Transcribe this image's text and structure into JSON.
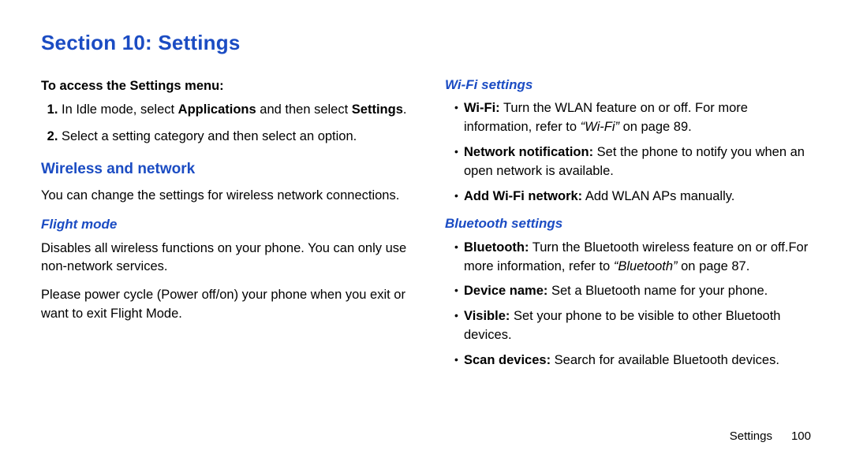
{
  "title": "Section 10: Settings",
  "left": {
    "access_heading": "To access the Settings menu:",
    "step1_pre": "In Idle mode, select ",
    "step1_bold1": "Applications",
    "step1_mid": " and then select ",
    "step1_bold2": "Settings",
    "step1_post": ".",
    "step2": "Select a setting category and then select an option.",
    "wireless_heading": "Wireless and network",
    "wireless_body": "You can change the settings for wireless network connections.",
    "flight_heading": "Flight mode",
    "flight_p1": "Disables all wireless functions on your phone. You can only use non-network services.",
    "flight_p2": "Please power cycle (Power off/on) your phone when you exit or want to exit Flight Mode."
  },
  "right": {
    "wifi_heading": "Wi-Fi settings",
    "wifi_b1_label": "Wi-Fi:",
    "wifi_b1_text": " Turn the WLAN feature on or off. For more information, refer to ",
    "wifi_b1_ref": "“Wi-Fi”",
    "wifi_b1_post": "  on page 89.",
    "wifi_b2_label": "Network notification:",
    "wifi_b2_text": " Set the phone to notify you when an open network is available.",
    "wifi_b3_label": "Add Wi-Fi network:",
    "wifi_b3_text": " Add WLAN APs manually.",
    "bt_heading": "Bluetooth settings",
    "bt_b1_label": "Bluetooth:",
    "bt_b1_text": " Turn the Bluetooth wireless feature on or off.For more information, refer to ",
    "bt_b1_ref": "“Bluetooth”",
    "bt_b1_post": "  on page 87.",
    "bt_b2_label": "Device name:",
    "bt_b2_text": " Set a Bluetooth name for your phone.",
    "bt_b3_label": "Visible:",
    "bt_b3_text": " Set your phone to be visible to other Bluetooth devices.",
    "bt_b4_label": "Scan devices:",
    "bt_b4_text": " Search for available Bluetooth devices."
  },
  "footer": {
    "label": "Settings",
    "page": "100"
  }
}
